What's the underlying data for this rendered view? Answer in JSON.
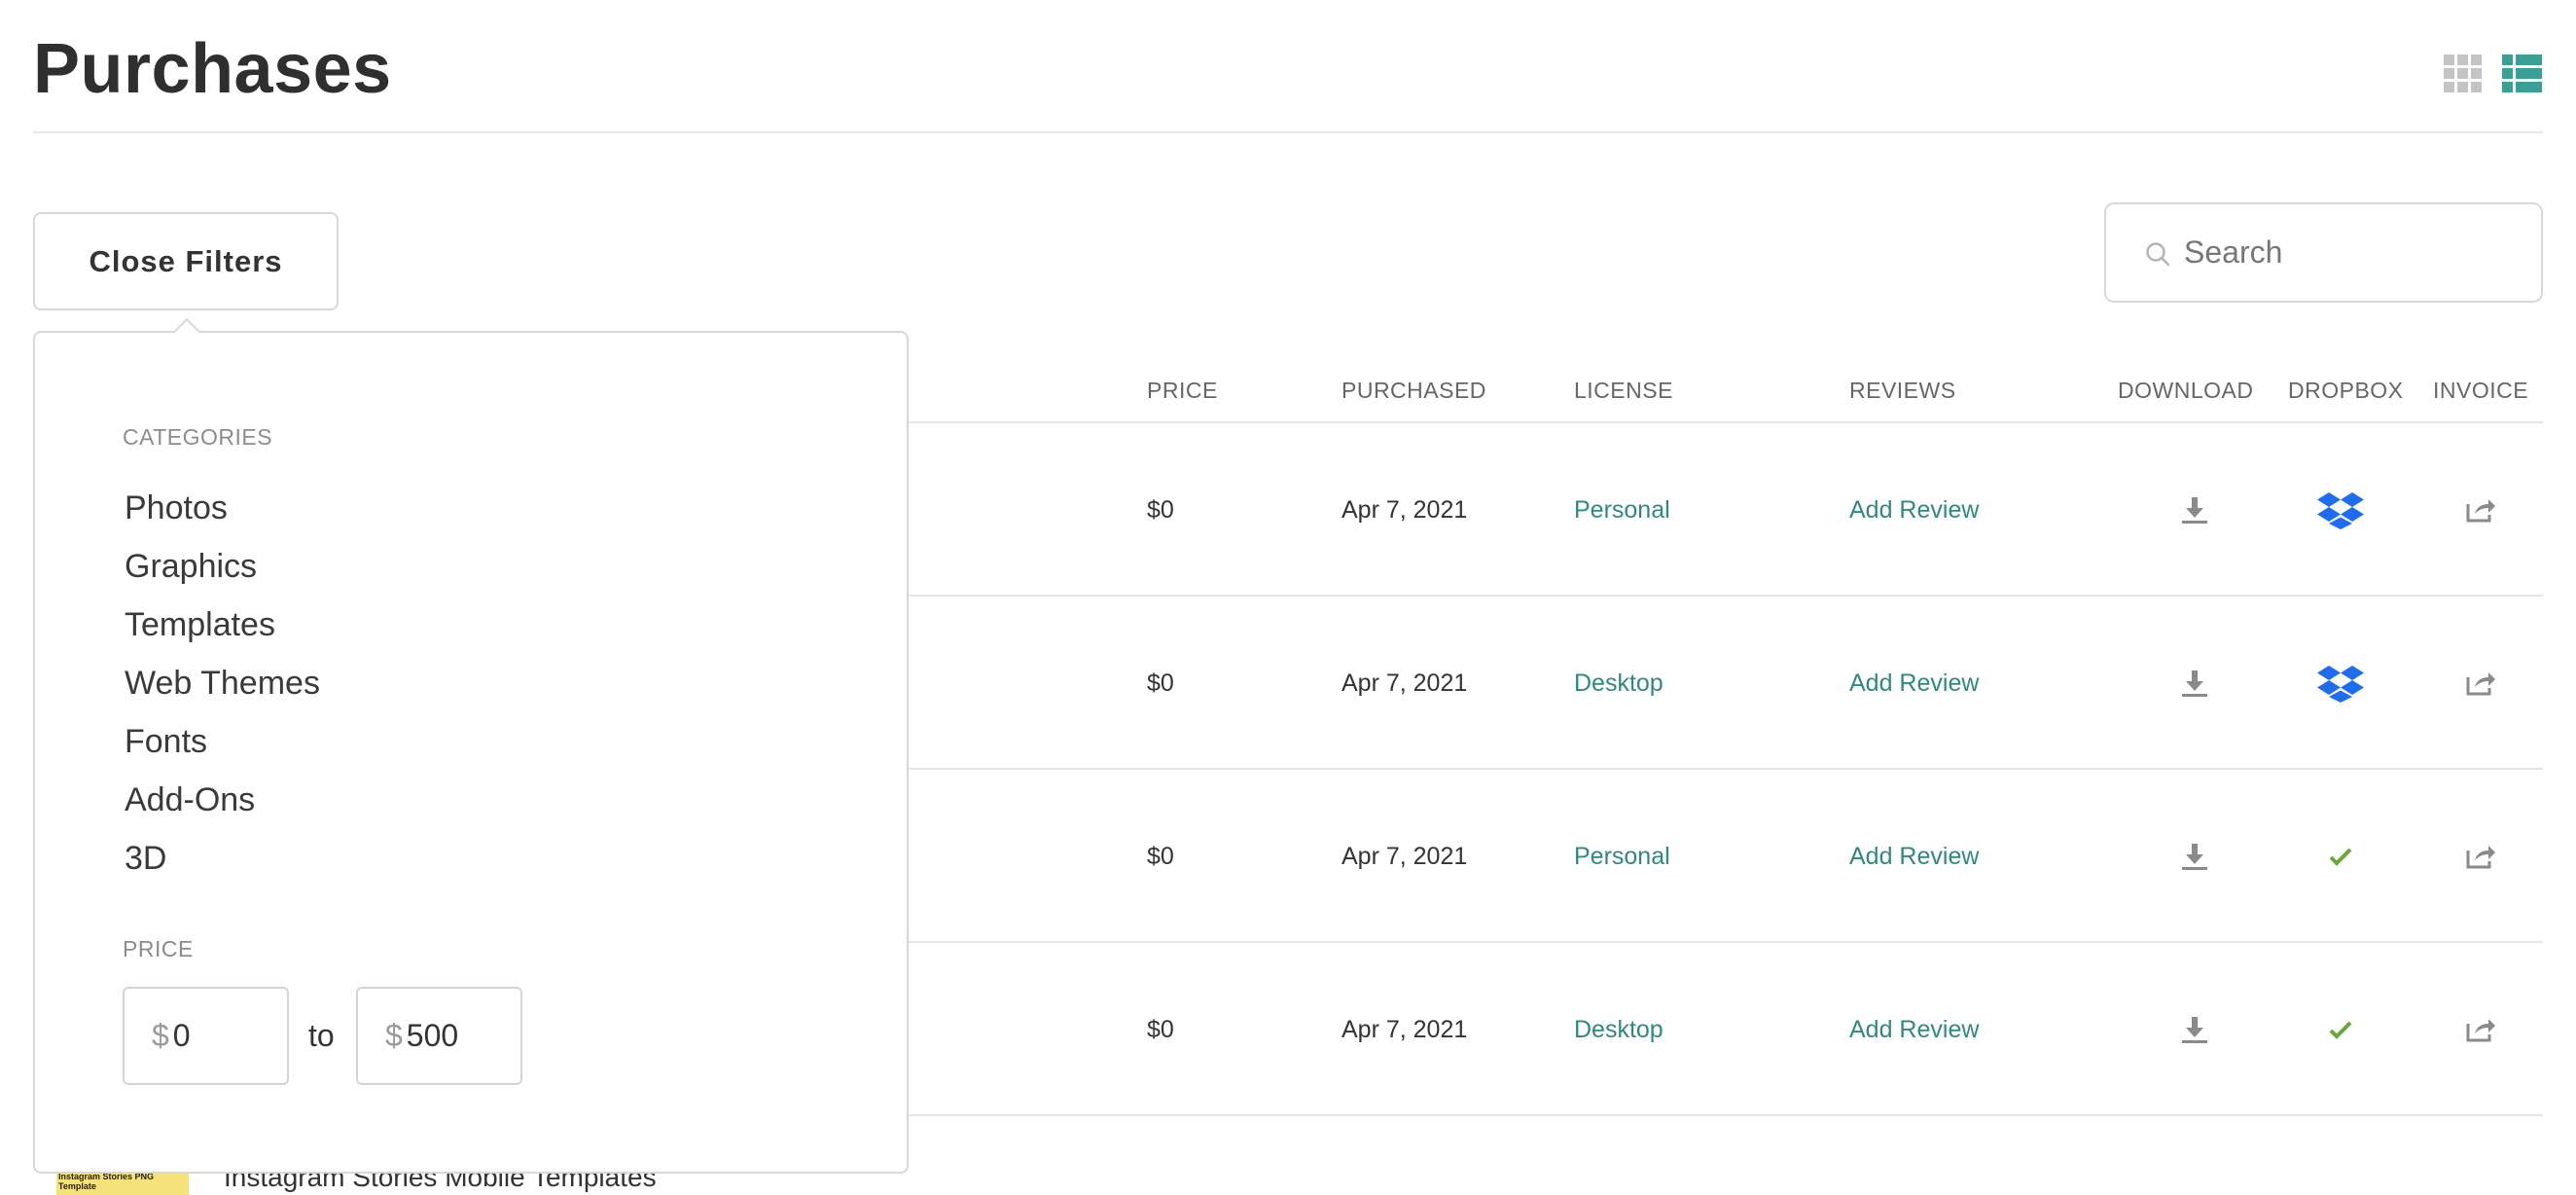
{
  "page": {
    "title": "Purchases"
  },
  "filters": {
    "close_label": "Close Filters",
    "categories_label": "CATEGORIES",
    "categories": [
      "Photos",
      "Graphics",
      "Templates",
      "Web Themes",
      "Fonts",
      "Add-Ons",
      "3D"
    ],
    "price_label": "PRICE",
    "price_min_currency": "$",
    "price_min": "0",
    "price_to": "to",
    "price_max_currency": "$",
    "price_max": "500"
  },
  "search": {
    "placeholder": "Search"
  },
  "table": {
    "headers": {
      "price": "PRICE",
      "purchased": "PURCHASED",
      "license": "LICENSE",
      "reviews": "REVIEWS",
      "download": "DOWNLOAD",
      "dropbox": "DROPBOX",
      "invoice": "INVOICE"
    },
    "rows": [
      {
        "price": "$0",
        "purchased": "Apr 7, 2021",
        "license": "Personal",
        "review": "Add Review",
        "dropbox": "dropbox-icon"
      },
      {
        "price": "$0",
        "purchased": "Apr 7, 2021",
        "license": "Desktop",
        "review": "Add Review",
        "dropbox": "dropbox-icon"
      },
      {
        "price": "$0",
        "purchased": "Apr 7, 2021",
        "license": "Personal",
        "review": "Add Review",
        "dropbox": "check-icon"
      },
      {
        "price": "$0",
        "purchased": "Apr 7, 2021",
        "license": "Desktop",
        "review": "Add Review",
        "dropbox": "check-icon"
      }
    ],
    "partial_row": {
      "title": "Instagram Stories Mobile Templates",
      "thumb_text": "Instagram Stories PNG Template"
    }
  },
  "colors": {
    "accent": "#2f8a7e",
    "list_view_active": "#3a9f94",
    "dropbox_blue": "#1e6cf0",
    "check_green": "#6aa83a"
  }
}
